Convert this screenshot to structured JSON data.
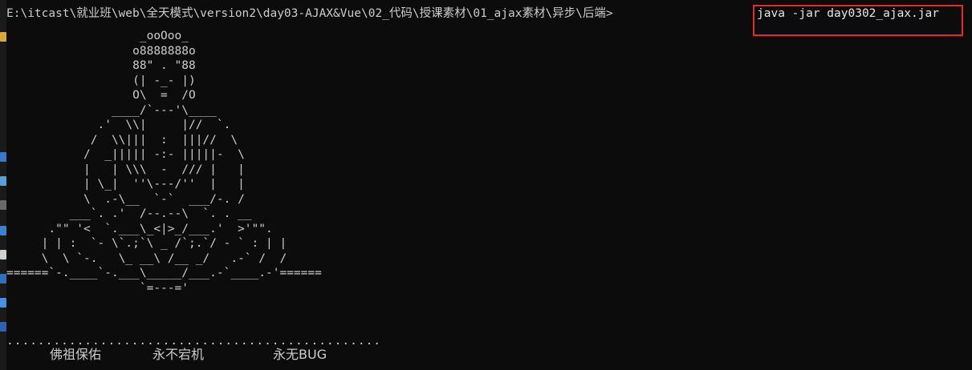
{
  "terminal": {
    "prompt_path": "E:\\itcast\\就业班\\web\\全天模式\\version2\\day03-AJAX&Vue\\02_代码\\授课素材\\01_ajax素材\\异步\\后端>",
    "command": "java -jar day0302_ajax.jar",
    "ascii_art": "                   _ooOoo_\n                  o8888888o\n                  88\" . \"88\n                  (| -_- |)\n                  O\\  =  /O\n               ____/`---'\\____\n             .'  \\\\|     |//  `.\n            /  \\\\|||  :  |||//  \\\n           /  _||||| -:- |||||-  \\\n           |   | \\\\\\  -  /// |   |\n           | \\_|  ''\\---/''  |   |\n           \\  .-\\__  `-`  ___/-. /\n         ___`. .'  /--.--\\  `. . __\n      .\"\" '<  `.___\\_<|>_/___.'  >'\"\".\n     | | :  `- \\`.;`\\ _ /`;.`/ - ` : | |\n     \\  \\ `-.   \\_ __\\ /__ _/   .-` /  /\n======`-.____`-.___\\_____/___.-`____.-'======\n                   `=---='",
    "separator": "................................................",
    "blessings": [
      "佛祖保佑",
      "永不宕机",
      "永无BUG"
    ]
  },
  "colors": {
    "background": "#0c0c0c",
    "text": "#cccccc",
    "highlight_border": "#e32b2b"
  }
}
